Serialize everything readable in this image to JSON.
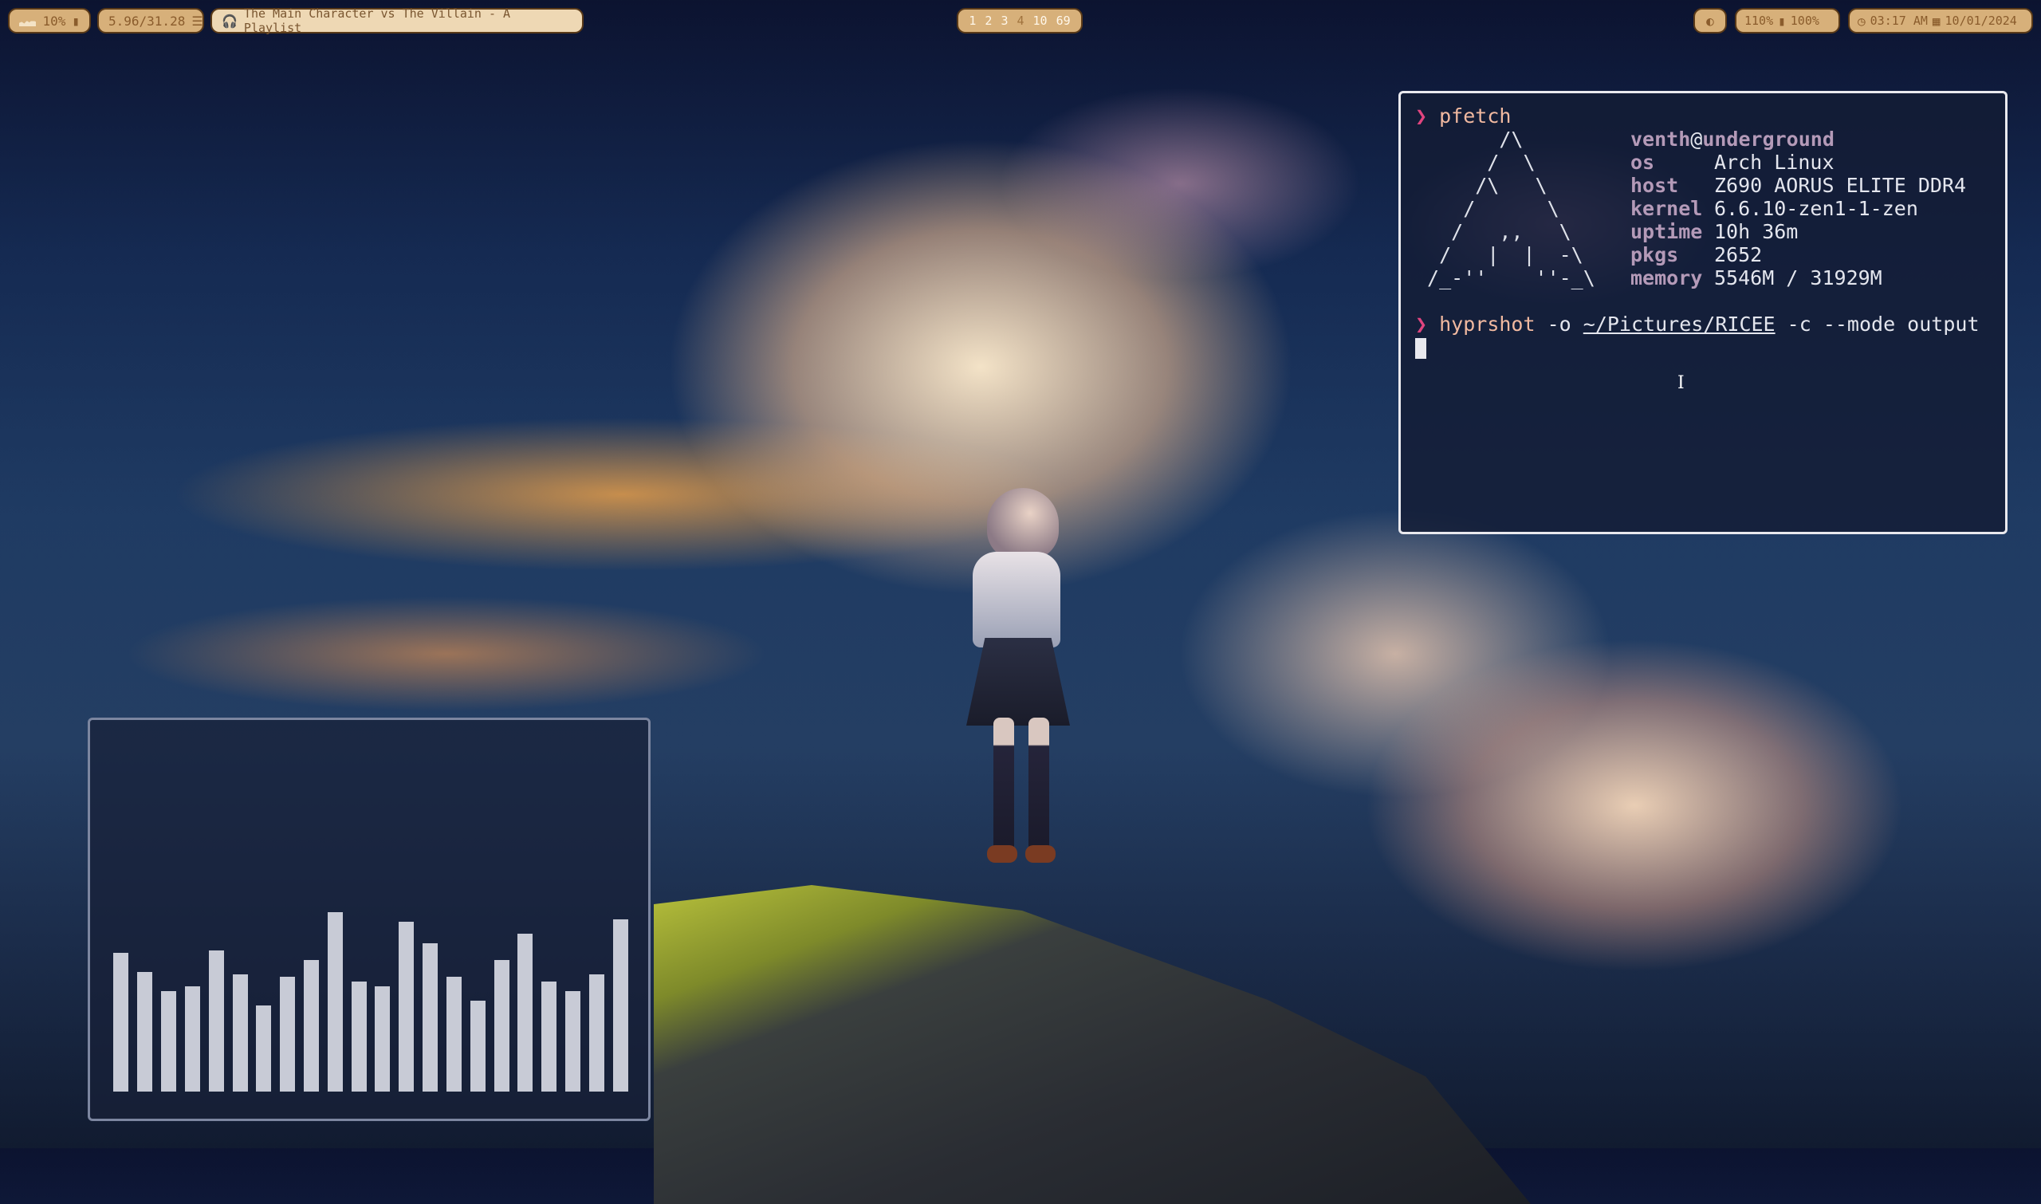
{
  "topbar": {
    "cpu": {
      "value": "10%",
      "icon": "cpu-graph-icon"
    },
    "memory": {
      "value": "5.96/31.28",
      "icon": "memory-icon"
    },
    "media": {
      "icon": "headphones-icon",
      "title": "The Main Character vs The Villain - A Playlist"
    },
    "workspaces": [
      {
        "label": "1",
        "active": false
      },
      {
        "label": "2",
        "active": false
      },
      {
        "label": "3",
        "active": false
      },
      {
        "label": "4",
        "active": true
      },
      {
        "label": "10",
        "active": false
      },
      {
        "label": "69",
        "active": false
      }
    ],
    "power_icon": "moon-icon",
    "volume": "110%",
    "battery": "100%",
    "time": "03:17 AM",
    "date": "10/01/2024"
  },
  "terminal": {
    "prompt_symbol": "❯",
    "command1": "pfetch",
    "ascii_art": [
      "       /\\",
      "      /  \\",
      "     /\\   \\",
      "    /      \\",
      "   /   ,,   \\",
      "  /   |  |  -\\",
      " /_-''    ''-_\\"
    ],
    "user": "venth",
    "at": "@",
    "host": "underground",
    "info": [
      {
        "key": "os",
        "value": "Arch Linux"
      },
      {
        "key": "host",
        "value": "Z690 AORUS ELITE DDR4"
      },
      {
        "key": "kernel",
        "value": "6.6.10-zen1-1-zen"
      },
      {
        "key": "uptime",
        "value": "10h 36m"
      },
      {
        "key": "pkgs",
        "value": "2652"
      },
      {
        "key": "memory",
        "value": "5546M / 31929M"
      }
    ],
    "command2": {
      "program": "hyprshot",
      "flag1": "-o",
      "path": "~/Pictures/RICEE",
      "rest": "-c --mode output"
    }
  },
  "visualizer": {
    "levels": [
      0.58,
      0.5,
      0.42,
      0.44,
      0.59,
      0.49,
      0.36,
      0.48,
      0.55,
      0.75,
      0.46,
      0.44,
      0.71,
      0.62,
      0.48,
      0.38,
      0.55,
      0.66,
      0.46,
      0.42,
      0.49,
      0.72
    ]
  },
  "colors": {
    "bar_pill": "#d7b07a",
    "terminal_border": "#e9e9ee",
    "prompt": "#e0457f",
    "visualizer_bar": "#c8cbd6"
  }
}
